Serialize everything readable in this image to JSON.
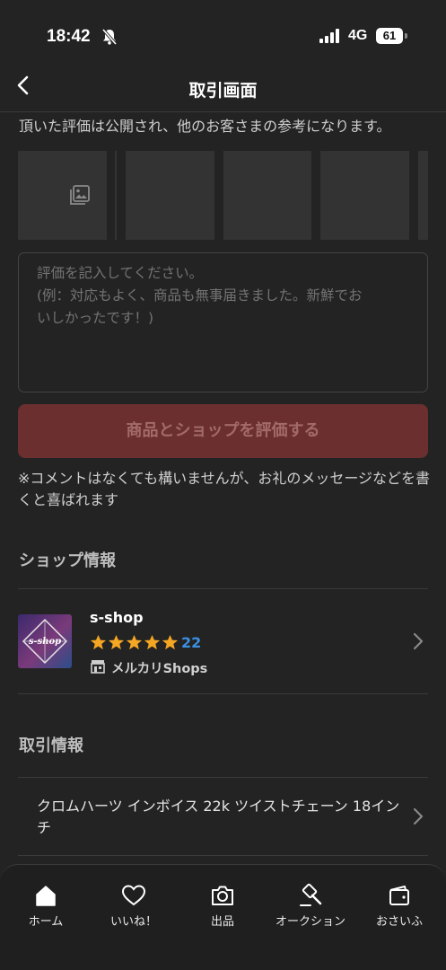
{
  "status_bar": {
    "time": "18:42",
    "network": "4G",
    "battery": "61"
  },
  "header": {
    "title": "取引画面"
  },
  "review": {
    "intro": "頂いた評価は公開され、他のお客さまの参考になります。",
    "placeholder_lines": [
      "評価を記入してください。",
      "(例：対応もよく、商品も無事届きました。新鮮でお",
      "いしかったです！)"
    ],
    "submit_label": "商品とショップを評価する",
    "note": "※コメントはなくても構いませんが、お礼のメッセージなどを書くと喜ばれます"
  },
  "shop_section": {
    "title": "ショップ情報",
    "shop_name": "s-shop",
    "logo_text": "s-shop",
    "rating_stars": 5,
    "review_count": "22",
    "shop_type": "メルカリShops"
  },
  "transaction_section": {
    "title": "取引情報",
    "item_title": "クロムハーツ インボイス 22k ツイストチェーン 18インチ"
  },
  "tab_bar": {
    "tabs": [
      {
        "label": "ホーム",
        "icon": "home-icon",
        "active": true
      },
      {
        "label": "いいね！",
        "icon": "heart-icon",
        "active": false
      },
      {
        "label": "出品",
        "icon": "camera-icon",
        "active": false
      },
      {
        "label": "オークション",
        "icon": "gavel-icon",
        "active": false
      },
      {
        "label": "おさいふ",
        "icon": "wallet-icon",
        "active": false
      }
    ]
  },
  "colors": {
    "background": "#232323",
    "accent_disabled": "#6b2f2f",
    "star": "#f5a623",
    "link_blue": "#3b8fe0"
  }
}
